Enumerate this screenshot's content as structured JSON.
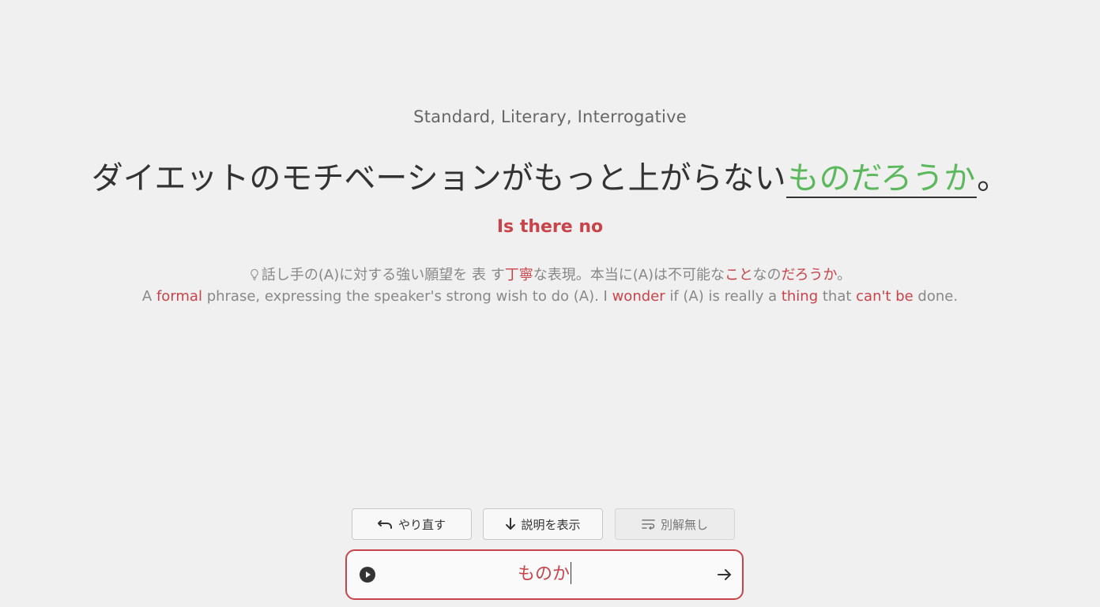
{
  "card": {
    "register": "Standard, Literary, Interrogative",
    "sentence_before": "ダイエットのモチベーションがもっと上がらない",
    "sentence_answer": "ものだろうか",
    "sentence_after": "。",
    "translation": "Is there no"
  },
  "explanation": {
    "icon": "lightbulb-icon",
    "jp": [
      {
        "text": "話し手の(A)に対する強い願望を 表 す",
        "hl": false
      },
      {
        "text": "丁寧",
        "hl": true
      },
      {
        "text": "な表現。本当に(A)は不可能な",
        "hl": false
      },
      {
        "text": "こと",
        "hl": true
      },
      {
        "text": "なの",
        "hl": false
      },
      {
        "text": "だろうか",
        "hl": true
      },
      {
        "text": "。",
        "hl": false
      }
    ],
    "en": [
      {
        "text": "A ",
        "hl": false
      },
      {
        "text": "formal",
        "hl": true
      },
      {
        "text": " phrase, expressing the speaker's strong wish to do (A). I ",
        "hl": false
      },
      {
        "text": "wonder",
        "hl": true
      },
      {
        "text": " if (A) is really a ",
        "hl": false
      },
      {
        "text": "thing",
        "hl": true
      },
      {
        "text": " that ",
        "hl": false
      },
      {
        "text": "can't be",
        "hl": true
      },
      {
        "text": " done.",
        "hl": false
      }
    ]
  },
  "controls": {
    "redo_label": "やり直す",
    "show_explanation_label": "説明を表示",
    "no_alternatives_label": "別解無し"
  },
  "answer_input": {
    "value": "ものか"
  },
  "colors": {
    "accent_red": "#c9444a",
    "correct_green": "#5cb85c"
  }
}
